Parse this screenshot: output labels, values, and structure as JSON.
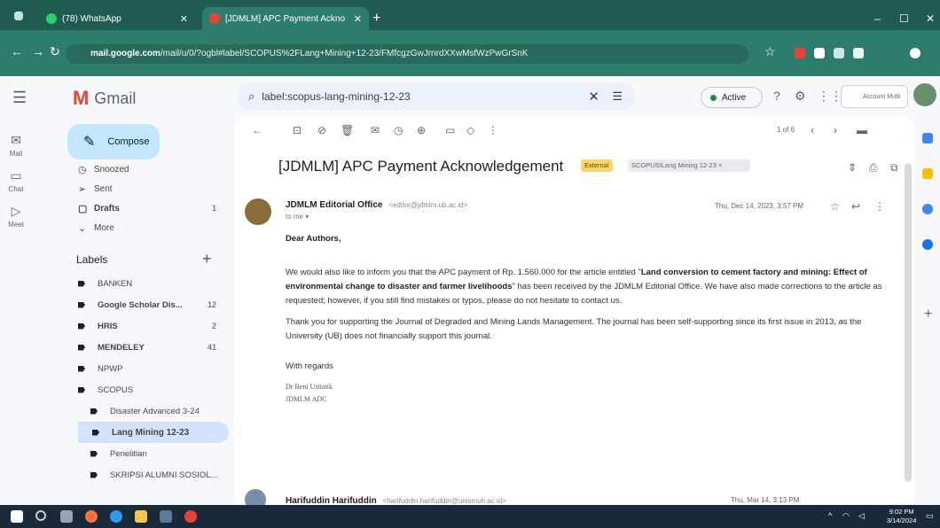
{
  "browser": {
    "tabs": [
      {
        "title": "(78) WhatsApp",
        "favicon_color": "#25d366"
      },
      {
        "title": "[JDMLM] APC Payment Ackno",
        "favicon_color": "#ea4335"
      }
    ],
    "new_tab": "+",
    "url_host": "mail.google.com",
    "url_rest": "/mail/u/0/?ogbl#label/SCOPUS%2FLang+Mining+12-23/FMfcgzGwJrnrdXXwMsfWzPwGrSnK",
    "window_controls": [
      "–",
      "☐",
      "✕"
    ]
  },
  "gmail": {
    "app_name": "Gmail",
    "compose_label": "Compose",
    "rail": [
      {
        "label": "Mail",
        "icon": "mail-icon"
      },
      {
        "label": "Chat",
        "icon": "chat-icon"
      },
      {
        "label": "Meet",
        "icon": "meet-icon"
      }
    ],
    "folders": [
      {
        "label": "Snoozed",
        "count": ""
      },
      {
        "label": "Sent",
        "count": ""
      },
      {
        "label": "Drafts",
        "count": "1"
      },
      {
        "label": "More",
        "count": ""
      }
    ],
    "labels_heading": "Labels",
    "labels": [
      {
        "label": "BANKEN",
        "count": "",
        "bold": false
      },
      {
        "label": "Google Scholar Dis...",
        "count": "12",
        "bold": true
      },
      {
        "label": "HRIS",
        "count": "2",
        "bold": true
      },
      {
        "label": "MENDELEY",
        "count": "41",
        "bold": true
      },
      {
        "label": "NPWP",
        "count": "",
        "bold": false
      },
      {
        "label": "SCOPUS",
        "count": "",
        "bold": false
      },
      {
        "label": "Disaster Advanced 3-24",
        "count": "",
        "bold": false
      },
      {
        "label": "Lang Mining 12-23",
        "count": "",
        "bold": true
      },
      {
        "label": "Penelitian",
        "count": "",
        "bold": false
      },
      {
        "label": "SKRIPSI ALUMNI SOSIOL...",
        "count": "",
        "bold": false
      }
    ],
    "search_value": "label:scopus-lang-mining-12-23",
    "status": "Active",
    "account_label": "Account Multi",
    "pager": "1 of 6",
    "subject": "[JDMLM] APC Payment Acknowledgement",
    "chip_external": "External",
    "chip_label": "SCOPUS/Lang Mining 12-23 ×",
    "message": {
      "sender": "JDMLM Editorial Office",
      "sender_email": "<editor@jdmlm.ub.ac.id>",
      "to": "to me ▾",
      "date": "Thu, Dec 14, 2023, 3:57 PM",
      "greeting": "Dear Authors,",
      "para1_a": "We would also like to inform you that the APC payment of Rp. 1.560.000 for the article entitled \"",
      "para1_title": "Land conversion to cement factory and mining: Effect of environmental change to disaster and farmer livelihoods",
      "para1_b": "\" has been received by the JDMLM Editorial Office. We have also made corrections to the article as requested; however, if you still find mistakes or typos, please do not hesitate to contact us.",
      "para2": "Thank you for supporting the Journal of Degraded and Mining Lands Management.  The journal has been self-supporting since its first issue in 2013, as the University (UB) does not financially support this journal.",
      "regards": "With regards",
      "sig_name": "Dr Reni Ustiatik",
      "sig_role": "JDMLM ADC"
    },
    "message2": {
      "sender": "Harifuddin Harifuddin",
      "sender_email": "<harifuddin.harifuddin@unismuh.ac.id>",
      "date": "Thu, Mar 14, 3:13 PM"
    }
  },
  "taskbar": {
    "time": "9:02 PM",
    "date": "3/14/2024"
  },
  "colors": {
    "chrome_dark": "#1f5b4f",
    "chrome": "#2e7d6c",
    "compose_bg": "#c2e7ff",
    "selected_label": "#d3e3fd",
    "external_chip": "#f9d56e"
  }
}
